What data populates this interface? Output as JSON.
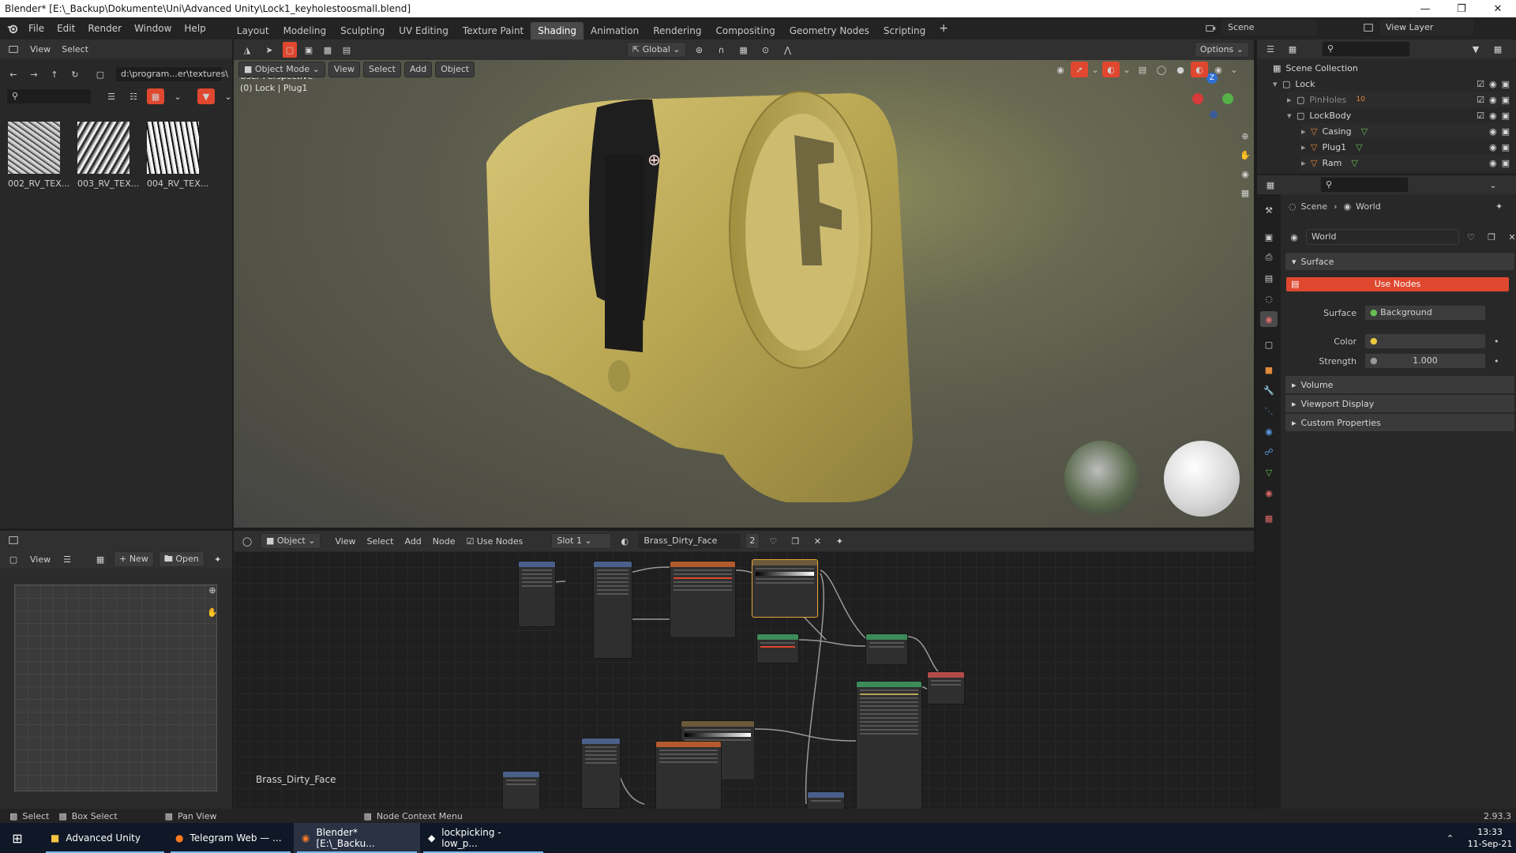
{
  "window": {
    "title": "Blender* [E:\\_Backup\\Dokumente\\Uni\\Advanced Unity\\Lock1_keyholestoosmall.blend]"
  },
  "menu": [
    "File",
    "Edit",
    "Render",
    "Window",
    "Help"
  ],
  "workspaces": [
    "Layout",
    "Modeling",
    "Sculpting",
    "UV Editing",
    "Texture Paint",
    "Shading",
    "Animation",
    "Rendering",
    "Compositing",
    "Geometry Nodes",
    "Scripting"
  ],
  "active_workspace": "Shading",
  "scene": {
    "label": "Scene",
    "view_layer": "View Layer"
  },
  "file_browser": {
    "view_label": "View",
    "select_label": "Select",
    "path": "d:\\program...er\\textures\\",
    "thumbnails": [
      "002_RV_TEX...",
      "003_RV_TEX...",
      "004_RV_TEX..."
    ]
  },
  "viewport": {
    "mode": "Object Mode",
    "menus": [
      "View",
      "Select",
      "Add",
      "Object"
    ],
    "orientation": "Global",
    "options_label": "Options",
    "perspective": "User Perspective",
    "context": "(0) Lock | Plug1",
    "gizmo_axes": {
      "z": "Z"
    }
  },
  "outliner": {
    "root": "Scene Collection",
    "items": [
      {
        "name": "Lock",
        "level": 0,
        "type": "collection"
      },
      {
        "name": "PinHoles",
        "level": 1,
        "type": "collection",
        "dim": true,
        "badge": "10"
      },
      {
        "name": "LockBody",
        "level": 1,
        "type": "collection"
      },
      {
        "name": "Casing",
        "level": 2,
        "type": "object"
      },
      {
        "name": "Plug1",
        "level": 2,
        "type": "object"
      },
      {
        "name": "Ram",
        "level": 2,
        "type": "object"
      }
    ]
  },
  "properties": {
    "breadcrumb_scene": "Scene",
    "breadcrumb_world": "World",
    "world_name": "World",
    "surface_section": "Surface",
    "use_nodes_label": "Use Nodes",
    "surface_label": "Surface",
    "surface_value": "Background",
    "color_label": "Color",
    "strength_label": "Strength",
    "strength_value": "1.000",
    "sections": [
      "Volume",
      "Viewport Display",
      "Custom Properties"
    ]
  },
  "image_editor": {
    "view_label": "View",
    "new_label": "New",
    "open_label": "Open"
  },
  "node_editor": {
    "type": "Object",
    "menus": [
      "View",
      "Select",
      "Add",
      "Node"
    ],
    "use_nodes_label": "Use Nodes",
    "slot": "Slot 1",
    "material": "Brass_Dirty_Face",
    "users": "2",
    "material_label": "Brass_Dirty_Face"
  },
  "statusbar": {
    "select": "Select",
    "box_select": "Box Select",
    "pan_view": "Pan View",
    "context_menu": "Node Context Menu",
    "version": "2.93.3"
  },
  "taskbar": {
    "items": [
      "Advanced Unity",
      "Telegram Web — ...",
      "Blender* [E:\\_Backu...",
      "lockpicking - low_p..."
    ],
    "time": "13:33",
    "date": "11-Sep-21"
  },
  "colors": {
    "accent_blue": "#4772b3",
    "use_nodes_red": "#e0472f",
    "brass": "#b8a652",
    "taskbar": "#101827"
  }
}
